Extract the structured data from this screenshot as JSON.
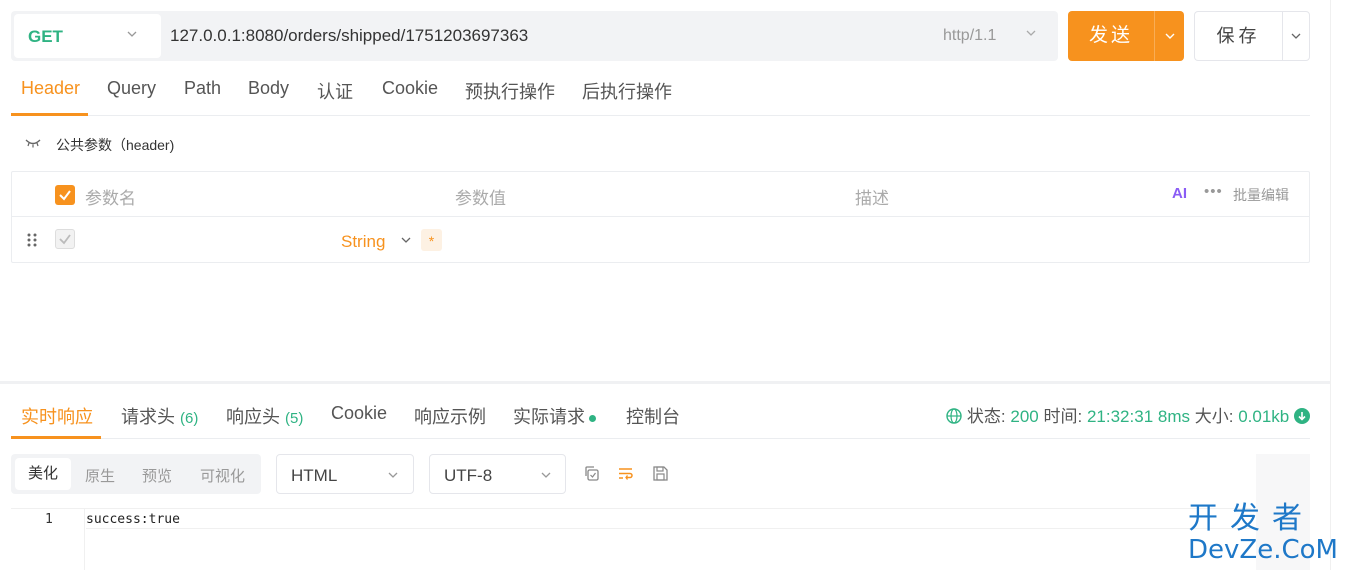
{
  "request": {
    "method": "GET",
    "url": "127.0.0.1:8080/orders/shipped/1751203697363",
    "protocol": "http/1.1",
    "send_label": "发送",
    "save_label": "保存"
  },
  "tabs": [
    "Header",
    "Query",
    "Path",
    "Body",
    "认证",
    "Cookie",
    "预执行操作",
    "后执行操作"
  ],
  "header_section": {
    "title": "公共参数（header)",
    "columns": [
      "参数名",
      "参数值",
      "描述"
    ],
    "ai_label": "AI",
    "batch_edit": "批量编辑",
    "row": {
      "type": "String",
      "required_mark": "*"
    }
  },
  "response_tabs": {
    "realtime": "实时响应",
    "req_headers": "请求头",
    "req_headers_count": "(6)",
    "resp_headers": "响应头",
    "resp_headers_count": "(5)",
    "cookie": "Cookie",
    "example": "响应示例",
    "actual": "实际请求",
    "console": "控制台"
  },
  "status": {
    "status_label": "状态:",
    "status_code": "200",
    "time_label": "时间:",
    "time_value": "21:32:31",
    "duration": "8ms",
    "size_label": "大小:",
    "size_value": "0.01kb"
  },
  "response_view": {
    "modes": [
      "美化",
      "原生",
      "预览",
      "可视化"
    ],
    "format": "HTML",
    "encoding": "UTF-8"
  },
  "code": {
    "line_no": "1",
    "text": "success:true"
  },
  "watermark": {
    "top": "开发者",
    "bottom": "DevZe.CoM"
  },
  "colors": {
    "accent": "#f7921e",
    "method": "#2fb383",
    "ai": "#8a5cf5"
  }
}
